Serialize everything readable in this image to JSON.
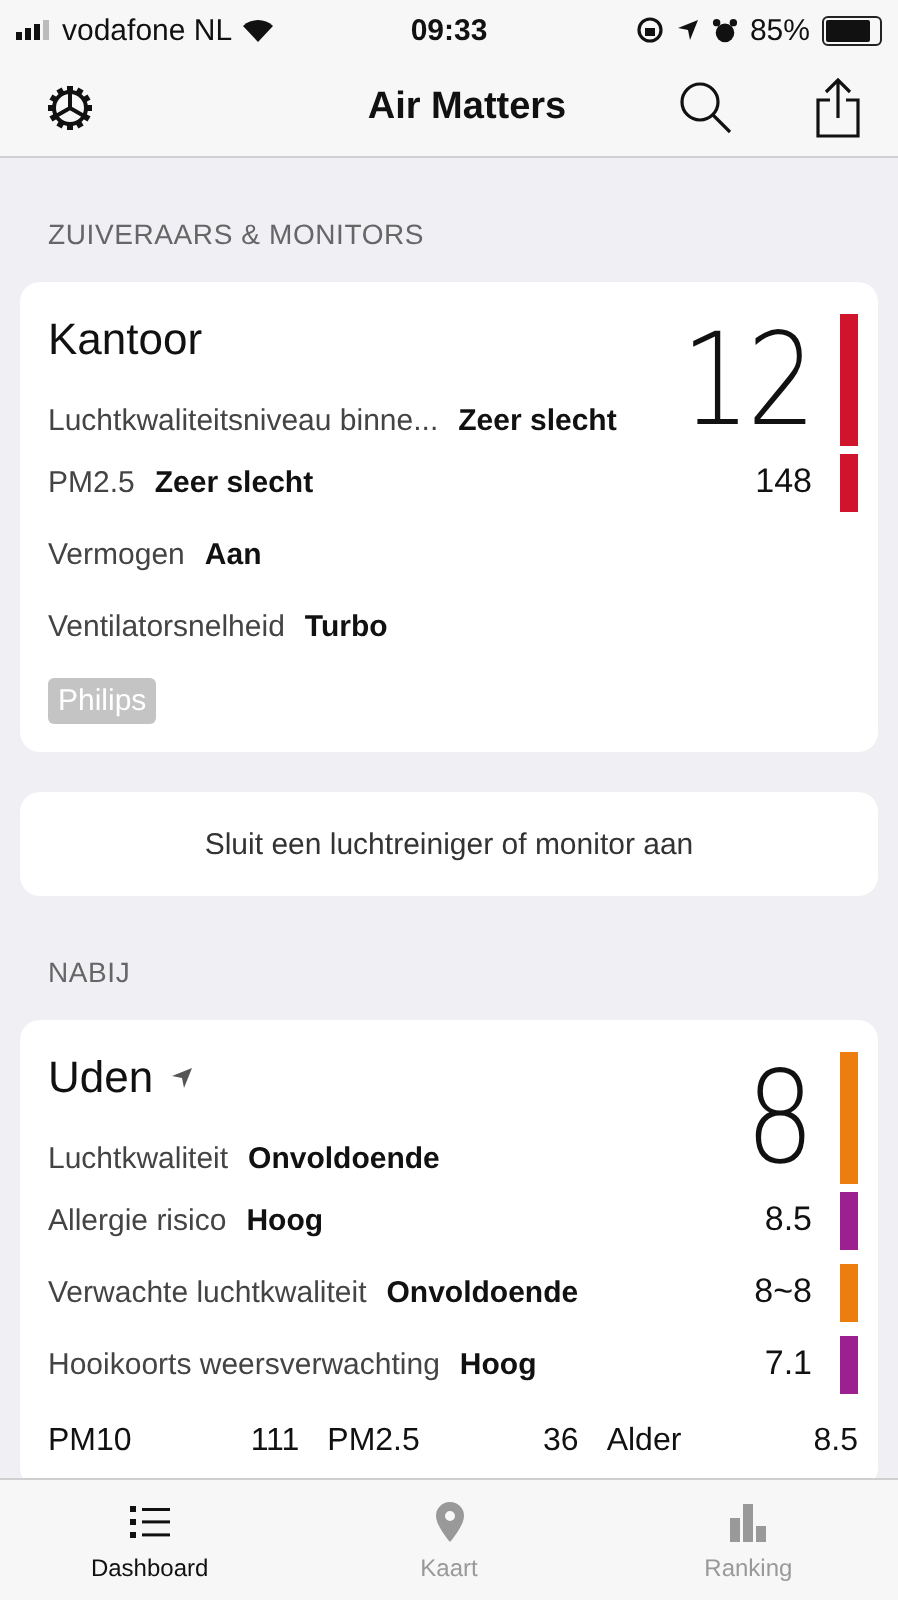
{
  "status_bar": {
    "carrier": "vodafone NL",
    "time": "09:33",
    "battery": "85%"
  },
  "nav": {
    "title": "Air Matters"
  },
  "devices": {
    "header": "ZUIVERAARS & MONITORS",
    "cards": [
      {
        "title": "Kantoor",
        "location": false,
        "index": "12",
        "color": "#d0142c",
        "rows": [
          {
            "label": "Luchtkwaliteitsniveau binne...",
            "value": "Zeer slecht"
          },
          {
            "label": "PM2.5",
            "value": "Zeer slecht",
            "number": "148",
            "color": "#d0142c"
          },
          {
            "label": "Vermogen",
            "value": "Aan"
          },
          {
            "label": "Ventilatorsnelheid",
            "value": "Turbo"
          }
        ],
        "tag": "Philips"
      }
    ]
  },
  "connect_button": "Sluit een luchtreiniger of monitor aan",
  "nearby": {
    "header": "NABIJ",
    "cards": [
      {
        "title": "Uden",
        "location": true,
        "index": "8",
        "color": "#ee7d10",
        "rows": [
          {
            "label": "Luchtkwaliteit",
            "value": "Onvoldoende"
          },
          {
            "label": "Allergie risico",
            "value": "Hoog",
            "number": "8.5",
            "color": "#9c2090"
          },
          {
            "label": "Verwachte luchtkwaliteit",
            "value": "Onvoldoende",
            "number": "8~8",
            "color": "#ee7d10"
          },
          {
            "label": "Hooikoorts weersverwachting",
            "value": "Hoog",
            "number": "7.1",
            "color": "#9c2090"
          }
        ],
        "pollutants": [
          {
            "name": "PM10",
            "value": "111"
          },
          {
            "name": "PM2.5",
            "value": "36"
          },
          {
            "name": "Alder",
            "value": "8.5"
          }
        ]
      }
    ]
  },
  "tabs": [
    {
      "label": "Dashboard",
      "kind": "list",
      "selected": true
    },
    {
      "label": "Kaart",
      "kind": "pin",
      "selected": false
    },
    {
      "label": "Ranking",
      "kind": "chart",
      "selected": false
    }
  ]
}
